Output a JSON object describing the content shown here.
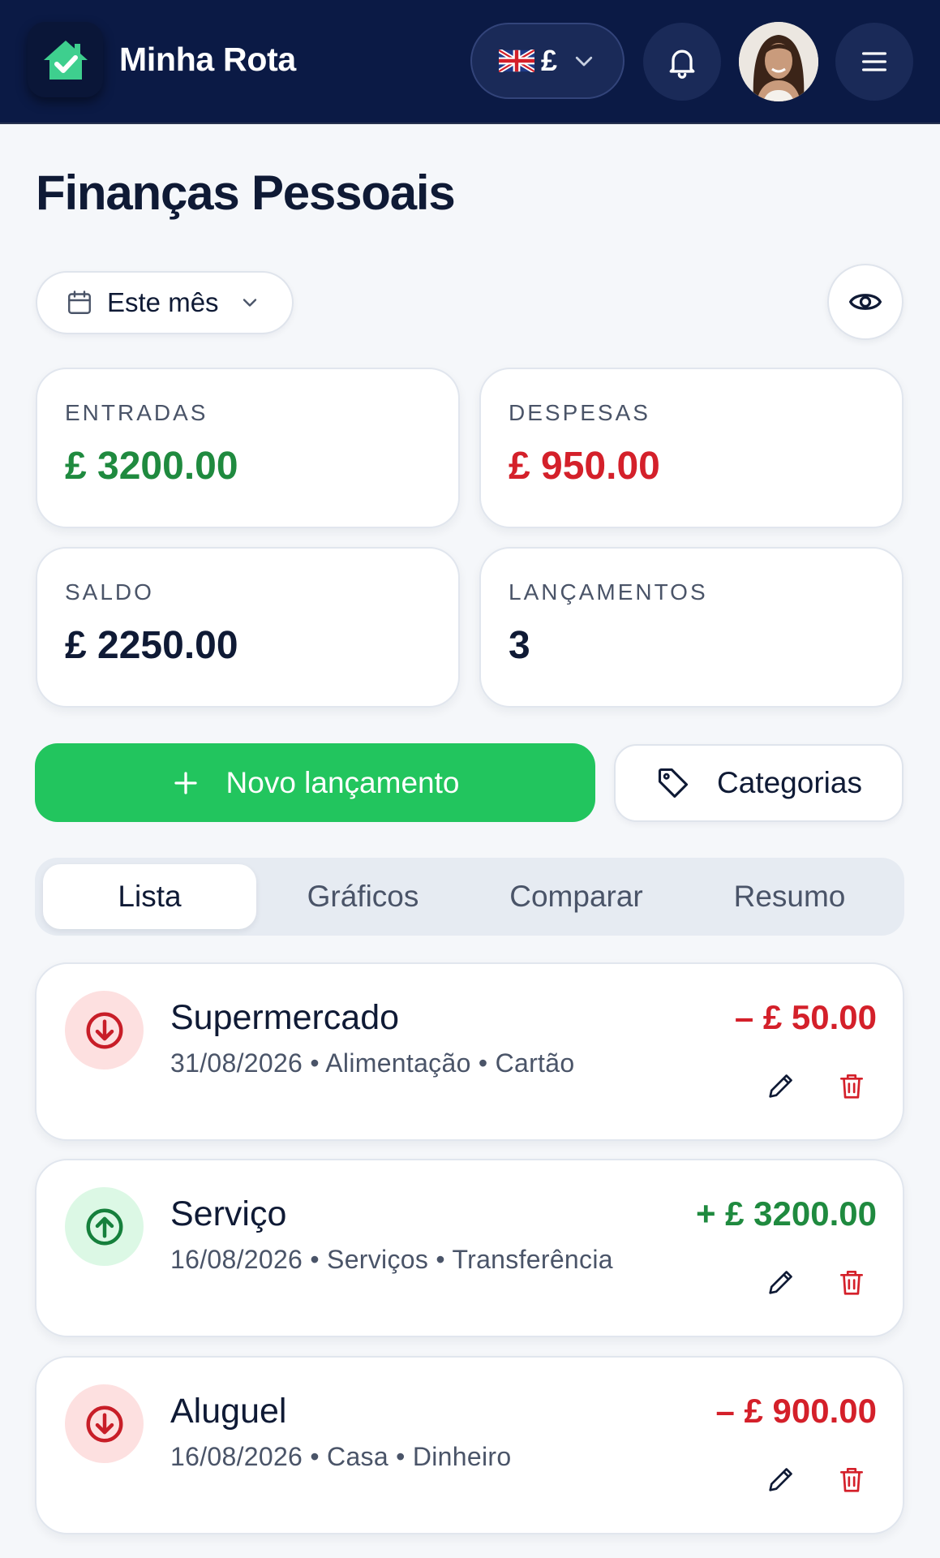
{
  "header": {
    "app_title": "Minha Rota",
    "currency_symbol": "£",
    "flag_icon": "uk-flag-icon",
    "icons": [
      "home-check-icon",
      "chevron-down-icon",
      "bell-icon",
      "menu-icon"
    ]
  },
  "page": {
    "title": "Finanças Pessoais",
    "period_label": "Este mês"
  },
  "stats": {
    "entradas": {
      "label": "ENTRADAS",
      "value": "£ 3200.00",
      "color": "#1f8a3f"
    },
    "despesas": {
      "label": "DESPESAS",
      "value": "£ 950.00",
      "color": "#d4202a"
    },
    "saldo": {
      "label": "SALDO",
      "value": "£ 2250.00",
      "color": "#0f1a35"
    },
    "lancamentos": {
      "label": "LANÇAMENTOS",
      "value": "3",
      "color": "#0f1a35"
    }
  },
  "actions": {
    "new_label": "Novo lançamento",
    "categories_label": "Categorias"
  },
  "tabs": [
    {
      "label": "Lista",
      "active": true
    },
    {
      "label": "Gráficos",
      "active": false
    },
    {
      "label": "Comparar",
      "active": false
    },
    {
      "label": "Resumo",
      "active": false
    }
  ],
  "transactions": [
    {
      "title": "Supermercado",
      "date": "31/08/2026",
      "category": "Alimentação",
      "method": "Cartão",
      "amount": "– £ 50.00",
      "type": "expense"
    },
    {
      "title": "Serviço",
      "date": "16/08/2026",
      "category": "Serviços",
      "method": "Transferência",
      "amount": "+ £ 3200.00",
      "type": "income"
    },
    {
      "title": "Aluguel",
      "date": "16/08/2026",
      "category": "Casa",
      "method": "Dinheiro",
      "amount": "– £ 900.00",
      "type": "expense"
    }
  ],
  "colors": {
    "header_bg": "#0b1a45",
    "accent_green": "#22c55e",
    "income": "#1f8a3f",
    "expense": "#d4202a"
  }
}
